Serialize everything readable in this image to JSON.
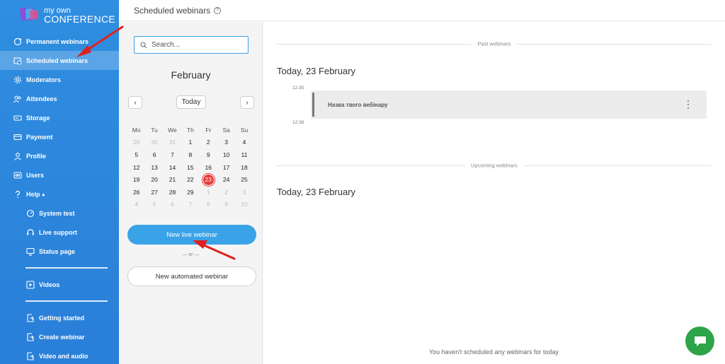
{
  "app": {
    "logo_line1": "my own",
    "logo_line2": "CONFERENCE"
  },
  "header": {
    "title": "Scheduled webinars",
    "help_glyph": "?"
  },
  "sidebar": {
    "items": [
      {
        "label": "Permanent webinars",
        "icon": "globe-refresh-icon"
      },
      {
        "label": "Scheduled webinars",
        "icon": "calendar-clock-icon",
        "active": true
      },
      {
        "label": "Moderators",
        "icon": "gear-icon"
      },
      {
        "label": "Attendees",
        "icon": "users-icon"
      },
      {
        "label": "Storage",
        "icon": "hard-drive-icon"
      },
      {
        "label": "Payment",
        "icon": "credit-card-icon"
      },
      {
        "label": "Profile",
        "icon": "user-icon"
      },
      {
        "label": "Users",
        "icon": "users-group-icon"
      },
      {
        "label": "Help",
        "icon": "question-icon",
        "caret": "▴"
      }
    ],
    "help_items": [
      {
        "label": "System test",
        "icon": "gauge-icon"
      },
      {
        "label": "Live support",
        "icon": "headset-icon"
      },
      {
        "label": "Status page",
        "icon": "monitor-icon"
      }
    ],
    "video_items": [
      {
        "label": "Videos",
        "icon": "play-icon"
      }
    ],
    "guide_items": [
      {
        "label": "Getting started",
        "icon": "export-icon"
      },
      {
        "label": "Create webinar",
        "icon": "export-icon"
      },
      {
        "label": "Video and audio",
        "icon": "export-icon"
      }
    ]
  },
  "calendar": {
    "search_placeholder": "Search...",
    "month": "February",
    "prev": "‹",
    "next": "›",
    "today_label": "Today",
    "weekdays": [
      "Mo",
      "Tu",
      "We",
      "Th",
      "Fr",
      "Sa",
      "Su"
    ],
    "weeks": [
      [
        {
          "d": "29",
          "m": true
        },
        {
          "d": "30",
          "m": true
        },
        {
          "d": "31",
          "m": true
        },
        {
          "d": "1"
        },
        {
          "d": "2"
        },
        {
          "d": "3"
        },
        {
          "d": "4"
        }
      ],
      [
        {
          "d": "5"
        },
        {
          "d": "6"
        },
        {
          "d": "7"
        },
        {
          "d": "8"
        },
        {
          "d": "9"
        },
        {
          "d": "10"
        },
        {
          "d": "11"
        }
      ],
      [
        {
          "d": "12"
        },
        {
          "d": "13"
        },
        {
          "d": "14"
        },
        {
          "d": "15"
        },
        {
          "d": "16"
        },
        {
          "d": "17"
        },
        {
          "d": "18"
        }
      ],
      [
        {
          "d": "19"
        },
        {
          "d": "20"
        },
        {
          "d": "21"
        },
        {
          "d": "22"
        },
        {
          "d": "23",
          "t": true
        },
        {
          "d": "24"
        },
        {
          "d": "25"
        }
      ],
      [
        {
          "d": "26"
        },
        {
          "d": "27"
        },
        {
          "d": "28"
        },
        {
          "d": "29"
        },
        {
          "d": "1",
          "m": true
        },
        {
          "d": "2",
          "m": true
        },
        {
          "d": "3",
          "m": true
        }
      ],
      [
        {
          "d": "4",
          "m": true
        },
        {
          "d": "5",
          "m": true
        },
        {
          "d": "6",
          "m": true
        },
        {
          "d": "7",
          "m": true
        },
        {
          "d": "8",
          "m": true
        },
        {
          "d": "9",
          "m": true
        },
        {
          "d": "10",
          "m": true
        }
      ]
    ],
    "new_live_label": "New live webinar",
    "or_label": "— or —",
    "new_automated_label": "New automated webinar"
  },
  "main": {
    "past_label": "Past webinars",
    "past_day_title": "Today, 23 February",
    "webinar": {
      "start_time": "12:35",
      "end_time": "12:38",
      "name": "Назва твого вебінару"
    },
    "upcoming_label": "Upcoming webinars",
    "upcoming_day_title": "Today, 23 February",
    "empty_message": "You haven't scheduled any webinars for today"
  },
  "colors": {
    "sidebar": "#2f8ee0",
    "accent": "#3aa3e8",
    "today": "#e53b3b",
    "chat": "#2da44a",
    "annotation": "#e0201f"
  }
}
